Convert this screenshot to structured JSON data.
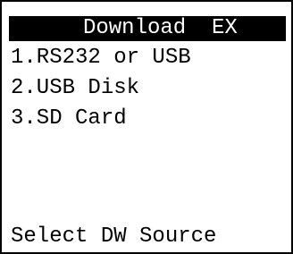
{
  "header": {
    "title": "  Download  EX"
  },
  "menu": {
    "items": [
      {
        "label": "1.RS232 or USB"
      },
      {
        "label": "2.USB Disk"
      },
      {
        "label": "3.SD Card"
      }
    ]
  },
  "footer": {
    "prompt": "Select DW Source"
  },
  "colors": {
    "foreground": "#000000",
    "background": "#ffffff",
    "title_bg": "#000000",
    "title_fg": "#ffffff"
  }
}
